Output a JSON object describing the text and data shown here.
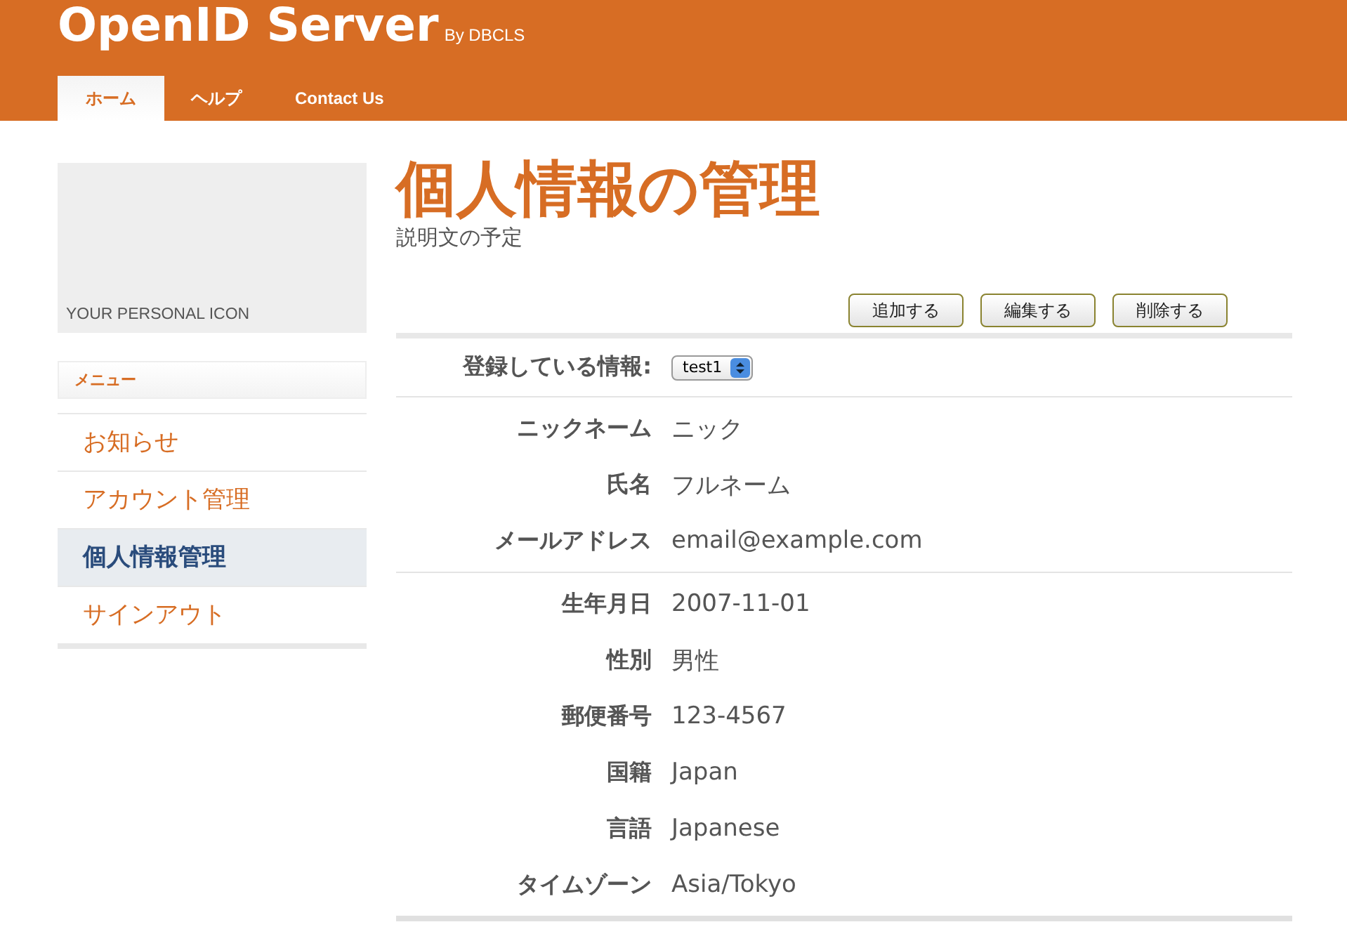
{
  "header": {
    "title": "OpenID Server",
    "subtitle": "By DBCLS"
  },
  "tabs": [
    {
      "label": "ホーム",
      "selected": true
    },
    {
      "label": "ヘルプ",
      "selected": false
    },
    {
      "label": "Contact Us",
      "selected": false
    }
  ],
  "sidebar": {
    "icon_label": "YOUR PERSONAL ICON",
    "menu_title": "メニュー",
    "items": [
      {
        "label": "お知らせ",
        "selected": false
      },
      {
        "label": "アカウント管理",
        "selected": false
      },
      {
        "label": "個人情報管理",
        "selected": true
      },
      {
        "label": "サインアウト",
        "selected": false
      }
    ]
  },
  "main": {
    "title": "個人情報の管理",
    "description": "説明文の予定",
    "buttons": [
      "追加する",
      "編集する",
      "削除する"
    ],
    "profile_select": {
      "label": "登録している情報:",
      "value": "test1"
    },
    "groups": [
      [
        {
          "label": "ニックネーム",
          "value": "ニック"
        },
        {
          "label": "氏名",
          "value": "フルネーム"
        },
        {
          "label": "メールアドレス",
          "value": "email@example.com"
        }
      ],
      [
        {
          "label": "生年月日",
          "value": "2007-11-01"
        },
        {
          "label": "性別",
          "value": "男性"
        },
        {
          "label": "郵便番号",
          "value": "123-4567"
        },
        {
          "label": "国籍",
          "value": "Japan"
        },
        {
          "label": "言語",
          "value": "Japanese"
        },
        {
          "label": "タイムゾーン",
          "value": "Asia/Tokyo"
        }
      ]
    ]
  }
}
